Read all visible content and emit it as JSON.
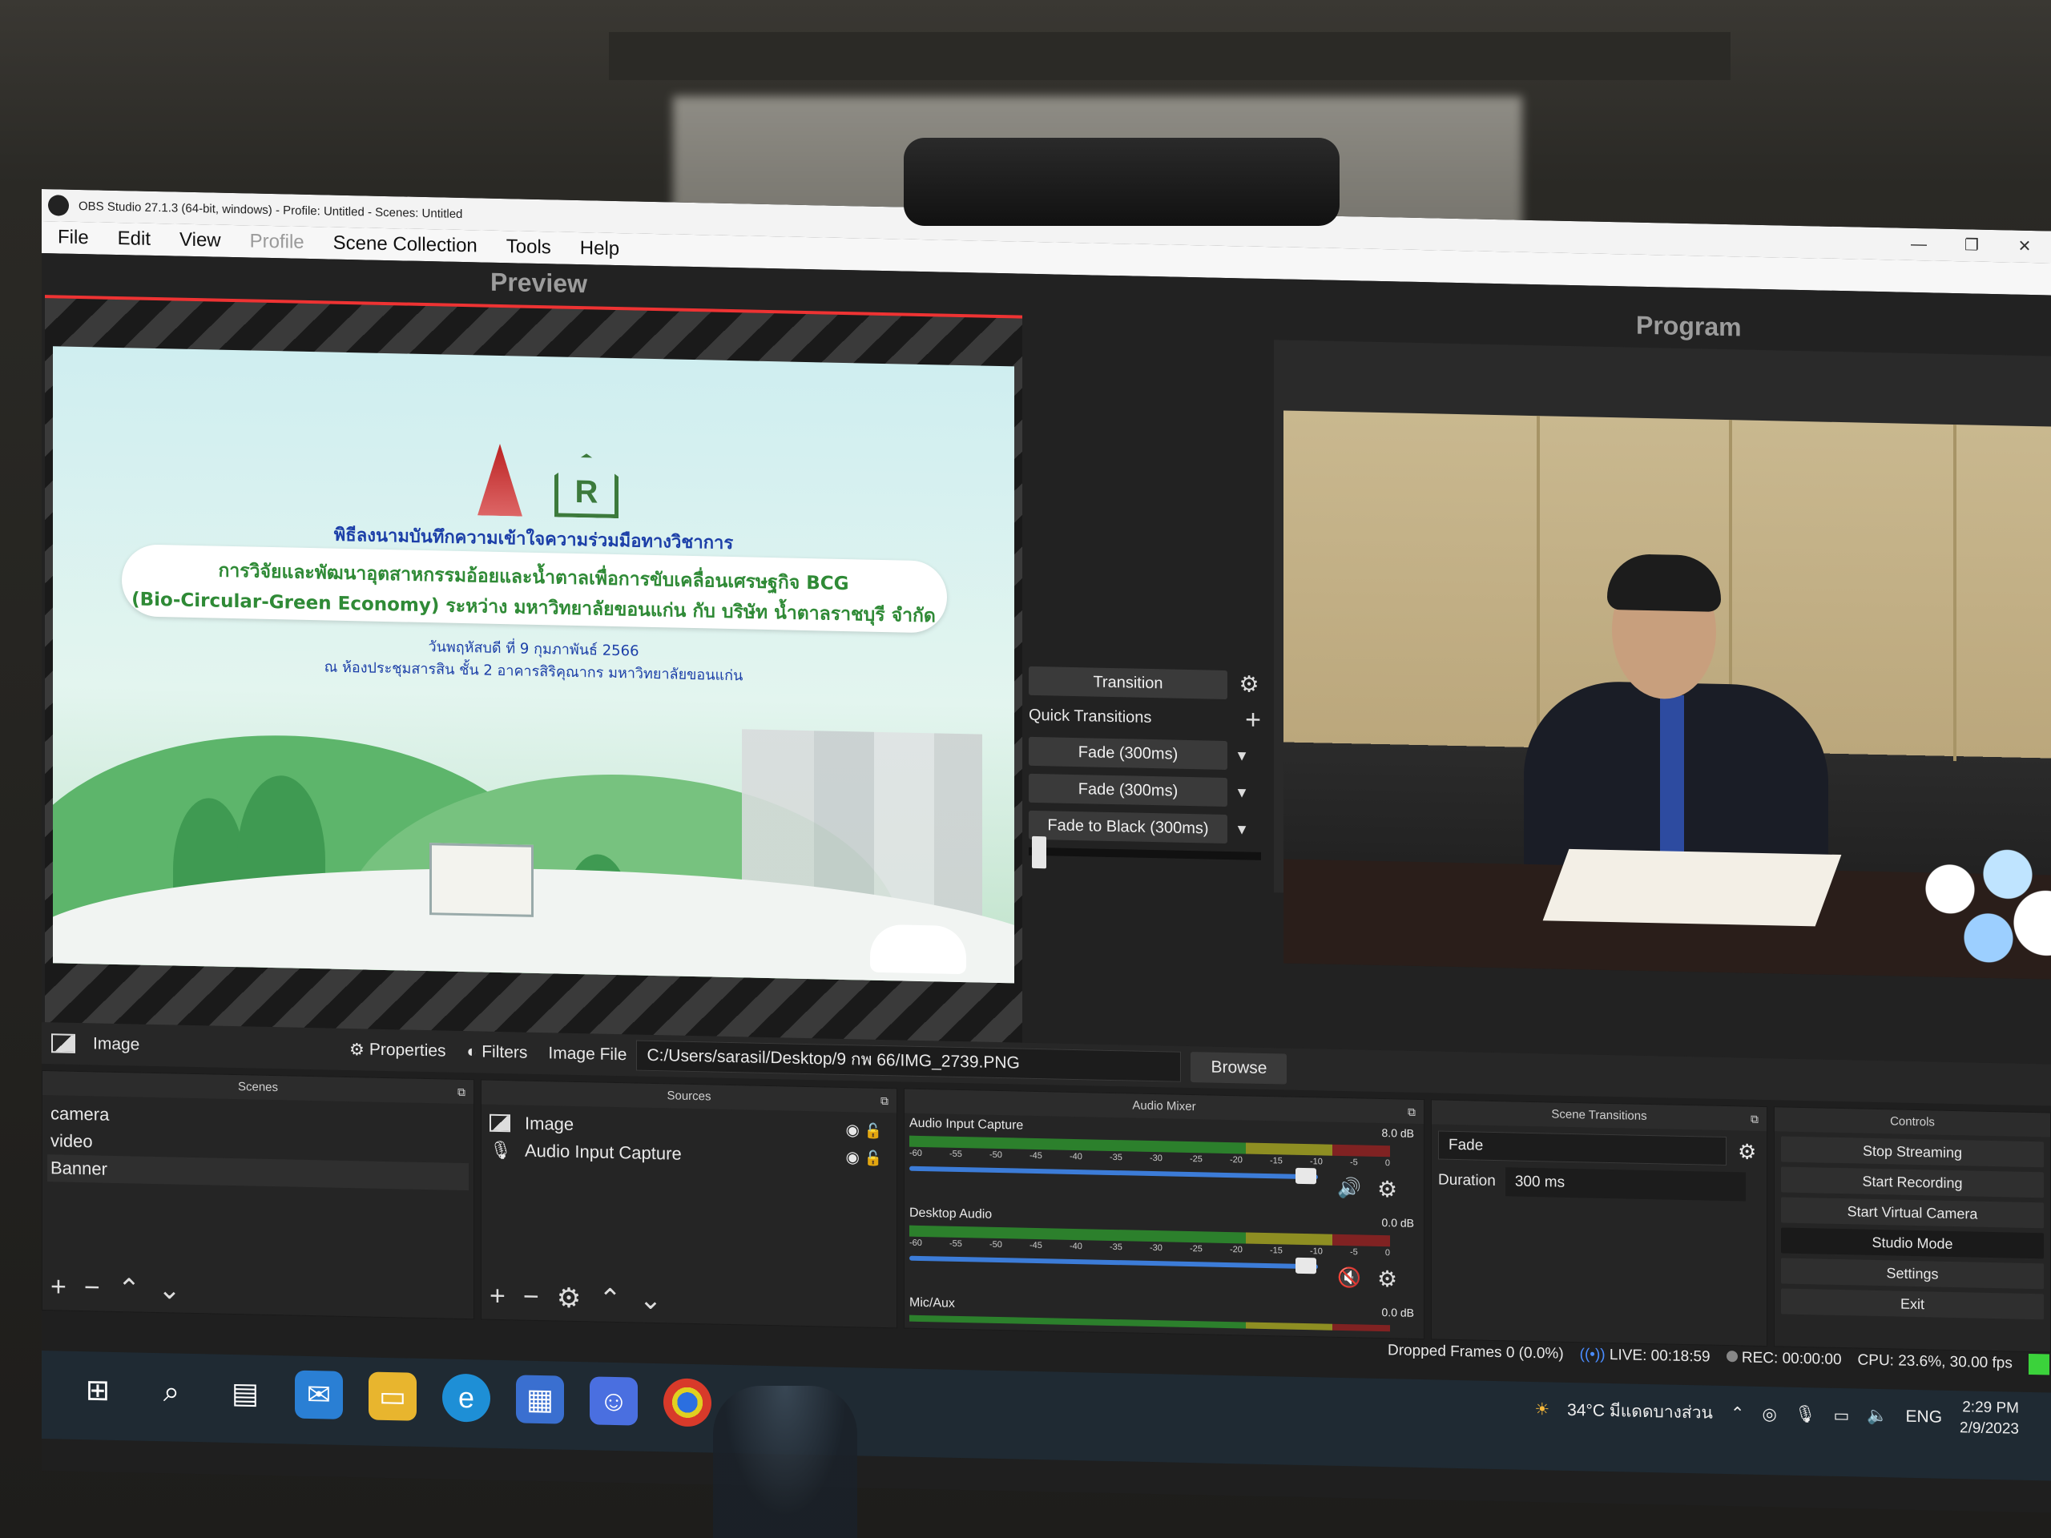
{
  "window": {
    "title": "OBS Studio 27.1.3 (64-bit, windows) - Profile: Untitled - Scenes: Untitled",
    "controls": [
      "—",
      "❐",
      "✕"
    ]
  },
  "menu": {
    "file": "File",
    "edit": "Edit",
    "view": "View",
    "profile": "Profile",
    "scene_collection": "Scene Collection",
    "tools": "Tools",
    "help": "Help"
  },
  "preview": {
    "label": "Preview",
    "slide": {
      "logo_letter": "R",
      "line1": "พิธีลงนามบันทึกความเข้าใจความร่วมมือทางวิชาการ",
      "line2": "การวิจัยและพัฒนาอุตสาหกรรมอ้อยและน้ำตาลเพื่อการขับเคลื่อนเศรษฐกิจ BCG",
      "line3": "(Bio-Circular-Green Economy) ระหว่าง มหาวิทยาลัยขอนแก่น กับ บริษัท น้ำตาลราชบุรี จำกัด",
      "line4": "วันพฤหัสบดี ที่ 9 กุมภาพันธ์ 2566",
      "line5": "ณ ห้องประชุมสารสิน ชั้น 2 อาคารสิริคุณากร มหาวิทยาลัยขอนแก่น"
    }
  },
  "program": {
    "label": "Program"
  },
  "transitions": {
    "transition_button": "Transition",
    "quick_transitions": "Quick Transitions",
    "items": [
      "Fade (300ms)",
      "Fade (300ms)",
      "Fade to Black (300ms)"
    ]
  },
  "source_toolbar": {
    "source_name": "Image",
    "properties": "Properties",
    "filters": "Filters",
    "image_file_label": "Image File",
    "image_file_path": "C:/Users/sarasil/Desktop/9 กพ 66/IMG_2739.PNG",
    "browse": "Browse"
  },
  "scenes": {
    "header": "Scenes",
    "items": [
      "camera",
      "video",
      "Banner"
    ],
    "selected_index": 2
  },
  "sources": {
    "header": "Sources",
    "items": [
      "Image",
      "Audio Input Capture"
    ]
  },
  "audio_mixer": {
    "header": "Audio Mixer",
    "scale": [
      "-60",
      "-55",
      "-50",
      "-45",
      "-40",
      "-35",
      "-30",
      "-25",
      "-20",
      "-15",
      "-10",
      "-5",
      "0"
    ],
    "channels": [
      {
        "name": "Audio Input Capture",
        "db": "8.0 dB",
        "muted": false,
        "volume": 0.97
      },
      {
        "name": "Desktop Audio",
        "db": "0.0 dB",
        "muted": true,
        "volume": 0.97
      },
      {
        "name": "Mic/Aux",
        "db": "0.0 dB",
        "muted": false,
        "volume": 0.97
      }
    ]
  },
  "scene_transitions": {
    "header": "Scene Transitions",
    "selected": "Fade",
    "duration_label": "Duration",
    "duration_value": "300 ms"
  },
  "controls": {
    "header": "Controls",
    "buttons": [
      "Stop Streaming",
      "Start Recording",
      "Start Virtual Camera",
      "Studio Mode",
      "Settings",
      "Exit"
    ]
  },
  "status": {
    "dropped_frames": "Dropped Frames 0 (0.0%)",
    "live": "LIVE: 00:18:59",
    "rec": "REC: 00:00:00",
    "cpu": "CPU: 23.6%, 30.00 fps"
  },
  "taskbar": {
    "weather": "34°C มีแดดบางส่วน",
    "language": "ENG",
    "time": "2:29 PM",
    "date": "2/9/2023"
  },
  "colors": {
    "accent_blue": "#3c7cd8",
    "preview_border": "#e33333",
    "live_green": "#3bd23b",
    "muted_red": "#e23535"
  }
}
